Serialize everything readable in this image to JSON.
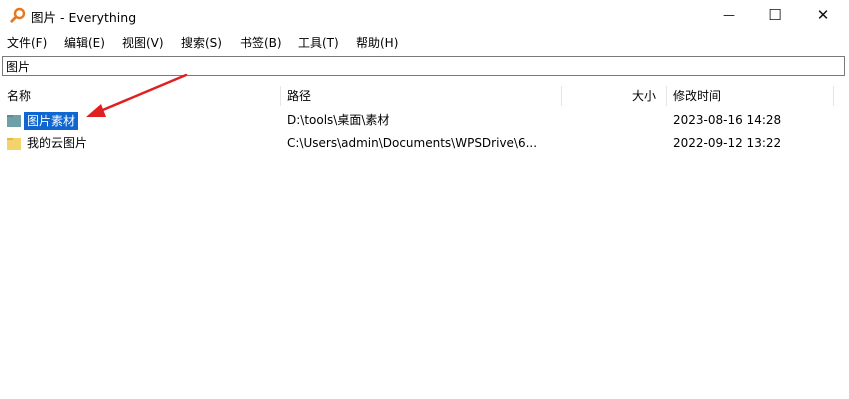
{
  "window": {
    "title": "图片 - Everything",
    "minimize_glyph": "—",
    "maximize_glyph": "☐",
    "close_glyph": "✕"
  },
  "menu": [
    "文件(F)",
    "编辑(E)",
    "视图(V)",
    "搜索(S)",
    "书签(B)",
    "工具(T)",
    "帮助(H)"
  ],
  "search": {
    "value": "图片"
  },
  "columns": {
    "name": "名称",
    "path": "路径",
    "size": "大小",
    "modified": "修改时间"
  },
  "rows": [
    {
      "name": "图片素材",
      "path": "D:\\tools\\桌面\\素材",
      "size": "",
      "modified": "2023-08-16 14:28",
      "icon": "folder-teal-icon",
      "selected": true
    },
    {
      "name": "我的云图片",
      "path": "C:\\Users\\admin\\Documents\\WPSDrive\\6...",
      "size": "",
      "modified": "2022-09-12 13:22",
      "icon": "folder-yellow-icon",
      "selected": false
    }
  ],
  "colors": {
    "selection": "#0f66d1",
    "arrow": "#e02020",
    "folder_yellow": "#f5d36b",
    "folder_teal": "#6f9fa8",
    "app_icon": "#e8761c"
  }
}
